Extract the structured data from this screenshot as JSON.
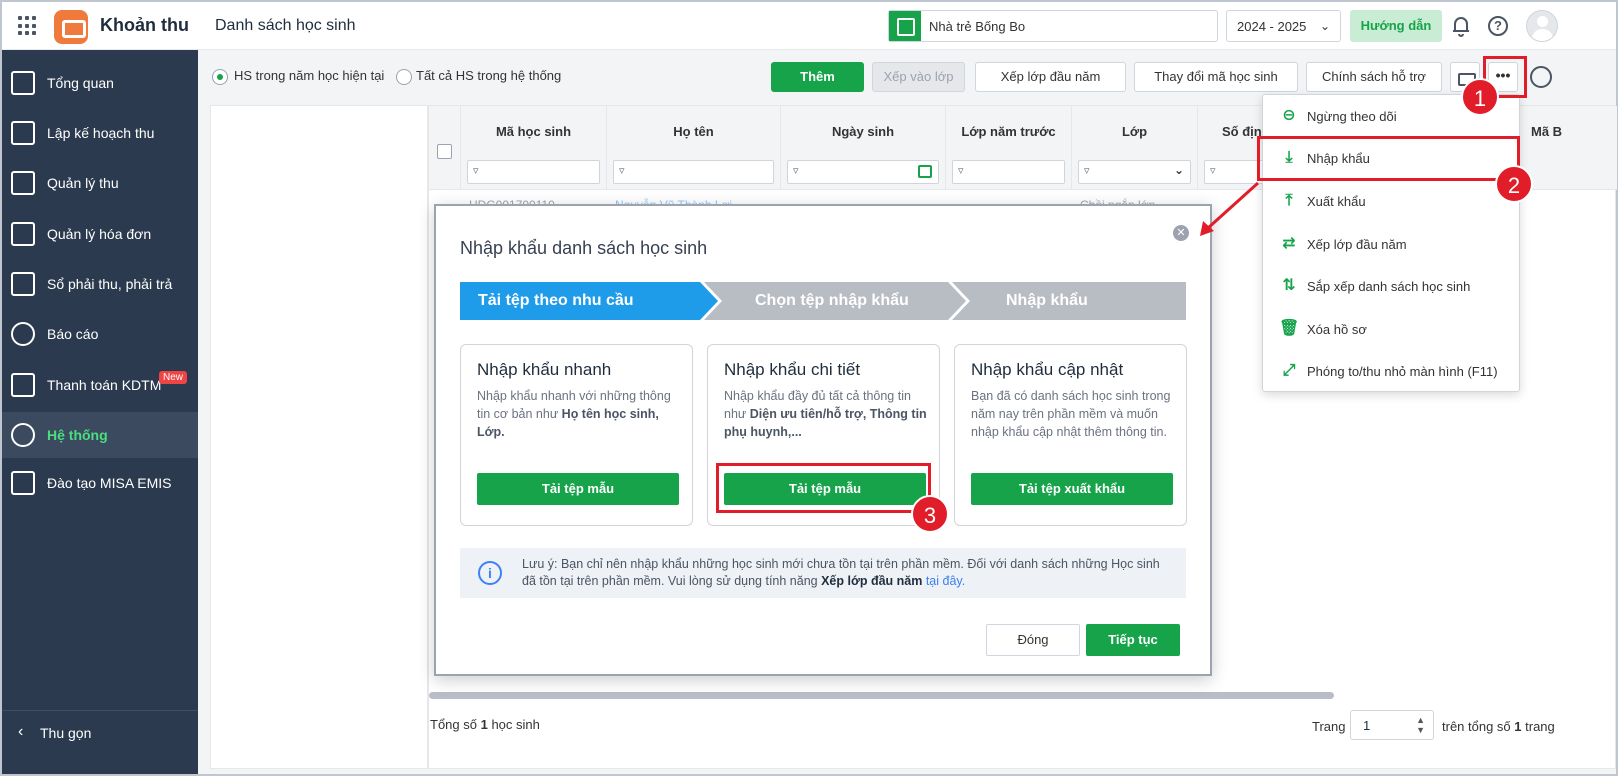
{
  "header": {
    "app_name": "Khoản thu",
    "page_title": "Danh sách học sinh",
    "school": "Nhà trẻ Bống Bo",
    "school_year": "2024 - 2025",
    "guide_label": "Hướng dẫn"
  },
  "sidebar": {
    "items": [
      {
        "label": "Tổng quan",
        "icon": "chart-icon"
      },
      {
        "label": "Lập kế hoạch thu",
        "icon": "calendar-dollar-icon"
      },
      {
        "label": "Quản lý thu",
        "icon": "hand-coin-icon"
      },
      {
        "label": "Quản lý hóa đơn",
        "icon": "invoice-icon"
      },
      {
        "label": "Sổ phải thu, phải trả",
        "icon": "ledger-icon"
      },
      {
        "label": "Báo cáo",
        "icon": "pie-icon"
      },
      {
        "label": "Thanh toán KDTM",
        "icon": "card-icon",
        "badge": "New"
      },
      {
        "label": "Hệ thống",
        "icon": "gear-icon",
        "active": true
      },
      {
        "label": "Đào tạo MISA EMIS",
        "icon": "book-icon"
      }
    ],
    "collapse_label": "Thu gọn"
  },
  "toolbar": {
    "radio_current": "HS trong năm học hiện tại",
    "radio_all": "Tất cả HS trong hệ thống",
    "add": "Thêm",
    "assign_class": "Xếp vào lớp",
    "start_year_class": "Xếp lớp đầu năm",
    "change_code": "Thay đổi mã học sinh",
    "support_policy": "Chính sách hỗ trợ",
    "more": "•••"
  },
  "table": {
    "columns": [
      "Mã học sinh",
      "Họ tên",
      "Ngày sinh",
      "Lớp năm trước",
      "Lớp",
      "Số định m",
      "Mã B"
    ],
    "row_partial": [
      "HDG001700110",
      "Nguyễn Vũ Thành Lợi",
      "Chồi ngắn lớp"
    ]
  },
  "footer": {
    "total_prefix": "Tổng số ",
    "total_count": "1",
    "total_suffix": " học sinh",
    "page_label": "Trang",
    "page_value": "1",
    "of_total_prefix": "trên tổng số ",
    "of_total_count": "1",
    "of_total_suffix": " trang"
  },
  "menu": {
    "items": [
      {
        "label": "Ngừng theo dõi",
        "icon": "minus-circle-icon",
        "glyph": "⊖"
      },
      {
        "label": "Nhập khẩu",
        "icon": "import-icon",
        "glyph": "⤓"
      },
      {
        "label": "Xuất khẩu",
        "icon": "export-icon",
        "glyph": "⤒"
      },
      {
        "label": "Xếp lớp đầu năm",
        "icon": "arrange-class-icon",
        "glyph": "⇄"
      },
      {
        "label": "Sắp xếp danh sách học sinh",
        "icon": "sort-az-icon",
        "glyph": "⇅"
      },
      {
        "label": "Xóa hồ sơ",
        "icon": "trash-icon",
        "glyph": "🗑"
      },
      {
        "label": "Phóng to/thu nhỏ màn hình (F11)",
        "icon": "expand-icon",
        "glyph": "⤢"
      }
    ]
  },
  "modal": {
    "title": "Nhập khẩu danh sách học sinh",
    "steps": [
      "Tải tệp theo nhu cầu",
      "Chọn tệp nhập khẩu",
      "Nhập khẩu"
    ],
    "cards": [
      {
        "title": "Nhập khẩu nhanh",
        "desc_plain": "Nhập khẩu nhanh với những thông tin cơ bản như ",
        "desc_bold": "Họ tên học sinh, Lớp.",
        "button": "Tải tệp mẫu"
      },
      {
        "title": "Nhập khẩu chi tiết",
        "desc_plain": "Nhập khẩu đầy đủ tất cả thông tin như ",
        "desc_bold": "Diện ưu tiên/hỗ trợ, Thông tin phụ huynh,...",
        "button": "Tải tệp mẫu"
      },
      {
        "title": "Nhập khẩu cập nhật",
        "desc_plain": "Bạn đã có danh sách học sinh trong năm nay trên phần mềm và muốn nhập khẩu cập nhật thêm thông tin.",
        "desc_bold": "",
        "button": "Tải tệp xuất khẩu"
      }
    ],
    "note_plain": "Lưu ý: Bạn chỉ nên nhập khẩu những học sinh mới chưa tồn tại trên phần mềm. Đối với danh sách những Học sinh đã tồn tại trên phần mềm. Vui lòng sử dụng tính năng ",
    "note_bold": "Xếp lớp đầu năm",
    "note_link": "tại đây.",
    "close": "Đóng",
    "continue": "Tiếp tục"
  },
  "annotations": [
    "1",
    "2",
    "3"
  ],
  "colors": {
    "primary_green": "#16a34a",
    "sidebar_bg": "#2b3a4e",
    "step_active": "#1e9be9",
    "step_inactive": "#b8bcc3",
    "annotation_red": "#e11d2a"
  }
}
